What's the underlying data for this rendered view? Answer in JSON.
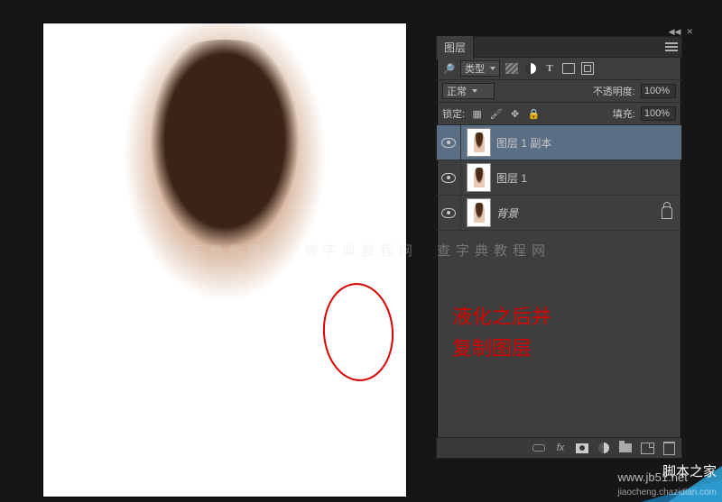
{
  "panel": {
    "tab": "图层",
    "filter": {
      "kind_label": "类型"
    },
    "blend": {
      "mode": "正常",
      "opacity_label": "不透明度:",
      "opacity_value": "100%"
    },
    "lock": {
      "label": "锁定:",
      "fill_label": "填充:",
      "fill_value": "100%"
    },
    "layers": [
      {
        "name": "图层 1 副本",
        "visible": true,
        "selected": true
      },
      {
        "name": "图层 1",
        "visible": true,
        "selected": false
      },
      {
        "name": "背景",
        "visible": true,
        "selected": false,
        "locked": true
      }
    ]
  },
  "annotation": {
    "line1": "液化之后并",
    "line2": "复制图层"
  },
  "watermark": {
    "band": "查字典教程网　查字典教程网　查字典教程网",
    "corner_url": "www.jb51.net",
    "corner_sub": "jiaocheng.chazidian.com",
    "badge": "脚本之家"
  }
}
